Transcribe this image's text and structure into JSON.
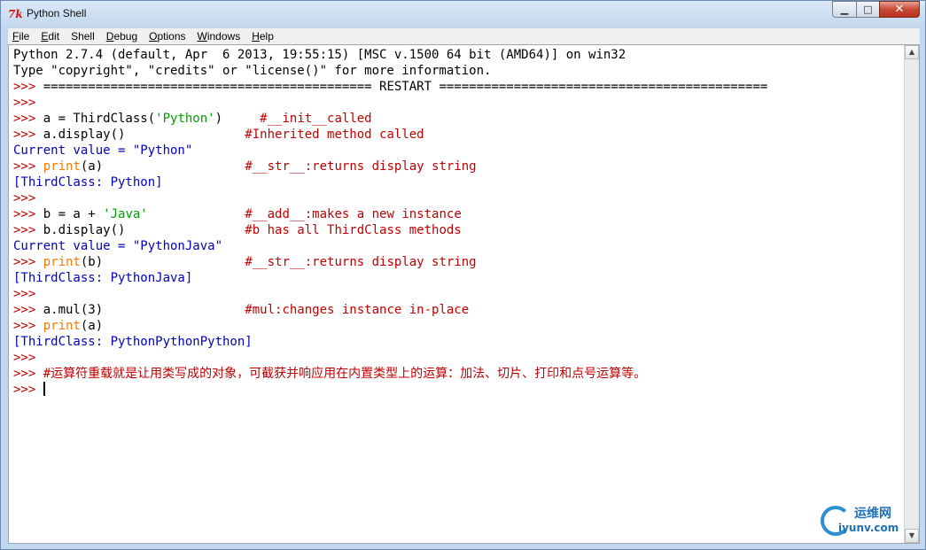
{
  "window": {
    "title": "Python Shell",
    "minimize_glyph": "▁",
    "maximize_glyph": "□",
    "close_glyph": "✕",
    "icon": "tk-feather-icon"
  },
  "menu": {
    "items": [
      {
        "first": "F",
        "rest": "ile"
      },
      {
        "first": "E",
        "rest": "dit"
      },
      {
        "first": "She",
        "rest": "ll",
        "underline_last": true
      },
      {
        "first": "D",
        "rest": "ebug"
      },
      {
        "first": "O",
        "rest": "ptions"
      },
      {
        "first": "W",
        "rest": "indows"
      },
      {
        "first": "H",
        "rest": "elp"
      }
    ]
  },
  "shell": {
    "lines": [
      [
        {
          "t": "Python 2.7.4 (default, Apr  6 2013, 19:55:15) [MSC v.1500 64 bit (AMD64)] on win32",
          "c": ""
        }
      ],
      [
        {
          "t": "Type \"copyright\", \"credits\" or \"license()\" for more information.",
          "c": ""
        }
      ],
      [
        {
          "t": ">>> ",
          "c": "c-cmt"
        },
        {
          "t": "============================================ RESTART ============================================",
          "c": ""
        }
      ],
      [
        {
          "t": ">>> ",
          "c": "c-cmt"
        }
      ],
      [
        {
          "t": ">>> ",
          "c": "c-cmt"
        },
        {
          "t": "a = ThirdClass(",
          "c": ""
        },
        {
          "t": "'Python'",
          "c": "c-str"
        },
        {
          "t": ")     ",
          "c": ""
        },
        {
          "t": "#__init__called",
          "c": "c-cmt"
        }
      ],
      [
        {
          "t": ">>> ",
          "c": "c-cmt"
        },
        {
          "t": "a.display()                ",
          "c": ""
        },
        {
          "t": "#Inherited method called",
          "c": "c-cmt"
        }
      ],
      [
        {
          "t": "Current value = \"Python\"",
          "c": "c-out"
        }
      ],
      [
        {
          "t": ">>> ",
          "c": "c-cmt"
        },
        {
          "t": "print",
          "c": "c-kw"
        },
        {
          "t": "(a)                   ",
          "c": ""
        },
        {
          "t": "#__str__:returns display string",
          "c": "c-cmt"
        }
      ],
      [
        {
          "t": "[ThirdClass: Python]",
          "c": "c-out"
        }
      ],
      [
        {
          "t": ">>> ",
          "c": "c-cmt"
        }
      ],
      [
        {
          "t": ">>> ",
          "c": "c-cmt"
        },
        {
          "t": "b = a + ",
          "c": ""
        },
        {
          "t": "'Java'",
          "c": "c-str"
        },
        {
          "t": "             ",
          "c": ""
        },
        {
          "t": "#__add__:makes a new instance",
          "c": "c-cmt"
        }
      ],
      [
        {
          "t": ">>> ",
          "c": "c-cmt"
        },
        {
          "t": "b.display()                ",
          "c": ""
        },
        {
          "t": "#b has all ThirdClass methods",
          "c": "c-cmt"
        }
      ],
      [
        {
          "t": "Current value = \"PythonJava\"",
          "c": "c-out"
        }
      ],
      [
        {
          "t": ">>> ",
          "c": "c-cmt"
        },
        {
          "t": "print",
          "c": "c-kw"
        },
        {
          "t": "(b)                   ",
          "c": ""
        },
        {
          "t": "#__str__:returns display string",
          "c": "c-cmt"
        }
      ],
      [
        {
          "t": "[ThirdClass: PythonJava]",
          "c": "c-out"
        }
      ],
      [
        {
          "t": ">>> ",
          "c": "c-cmt"
        }
      ],
      [
        {
          "t": ">>> ",
          "c": "c-cmt"
        },
        {
          "t": "a.mul(3)                   ",
          "c": ""
        },
        {
          "t": "#mul:changes instance in-place",
          "c": "c-cmt"
        }
      ],
      [
        {
          "t": ">>> ",
          "c": "c-cmt"
        },
        {
          "t": "print",
          "c": "c-kw"
        },
        {
          "t": "(a)",
          "c": ""
        }
      ],
      [
        {
          "t": "[ThirdClass: PythonPythonPython]",
          "c": "c-out"
        }
      ],
      [
        {
          "t": ">>> ",
          "c": "c-cmt"
        }
      ],
      [
        {
          "t": ">>> ",
          "c": "c-cmt"
        },
        {
          "t": "#运算符重载就是让用类写成的对象，可截获并响应用在内置类型上的运算：加法、切片、打印和点号运算等。",
          "c": "c-cmt"
        }
      ],
      [
        {
          "t": ">>> ",
          "c": "c-cmt"
        },
        {
          "t": "",
          "c": "",
          "cursor": true
        }
      ]
    ]
  },
  "scroll": {
    "up_glyph": "▲",
    "down_glyph": "▼"
  },
  "watermark": {
    "cn": "运维网",
    "en": "iyunv.com"
  }
}
